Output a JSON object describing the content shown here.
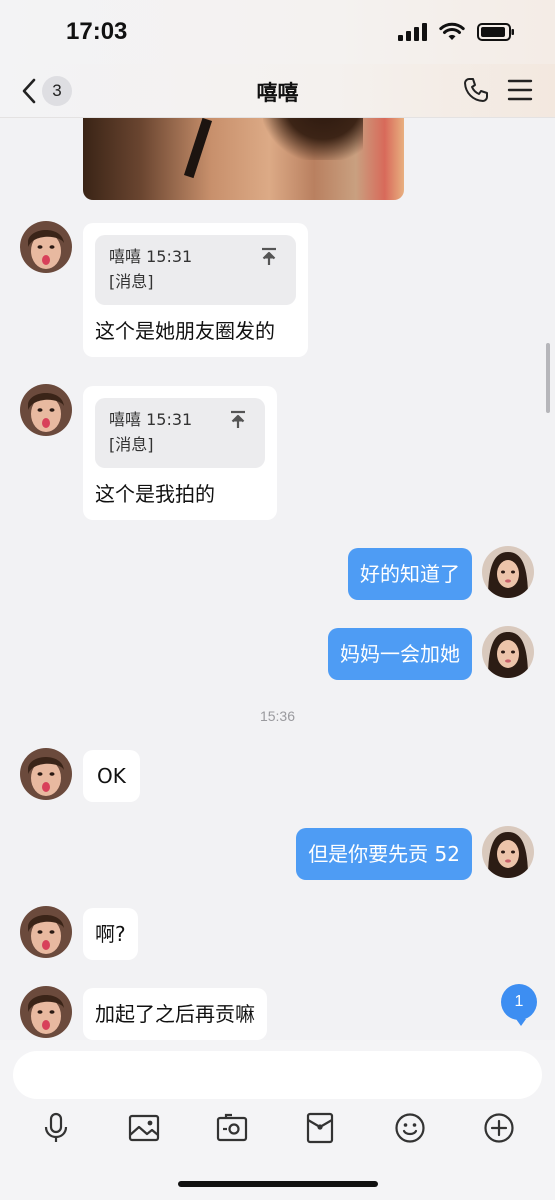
{
  "status_bar": {
    "time": "17:03"
  },
  "nav": {
    "back_count": "3",
    "title": "嘻嘻"
  },
  "messages": [
    {
      "side": "in",
      "type": "quote",
      "quote_header": "嘻嘻 15:31",
      "quote_body": "[消息]",
      "text": "这个是她朋友圈发的"
    },
    {
      "side": "in",
      "type": "quote",
      "quote_header": "嘻嘻 15:31",
      "quote_body": "[消息]",
      "text": "这个是我拍的"
    },
    {
      "side": "out",
      "type": "text",
      "text": "好的知道了"
    },
    {
      "side": "out",
      "type": "text",
      "text": "妈妈一会加她"
    },
    {
      "type": "time",
      "text": "15:36"
    },
    {
      "side": "in",
      "type": "text",
      "text": "OK"
    },
    {
      "side": "out",
      "type": "text",
      "text": "但是你要先贡 52"
    },
    {
      "side": "in",
      "type": "text",
      "text": "啊?"
    },
    {
      "side": "in",
      "type": "text",
      "text": "加起了之后再贡嘛"
    }
  ],
  "unread_badge": "1",
  "input": {
    "placeholder": ""
  },
  "toolbar_icons": [
    "microphone-icon",
    "photo-icon",
    "camera-icon",
    "red-packet-icon",
    "emoji-icon",
    "plus-icon"
  ],
  "colors": {
    "outgoing_bubble": "#4e9cf4",
    "incoming_bubble": "#ffffff",
    "background": "#f2f2f4",
    "badge": "#3d8ef2"
  }
}
